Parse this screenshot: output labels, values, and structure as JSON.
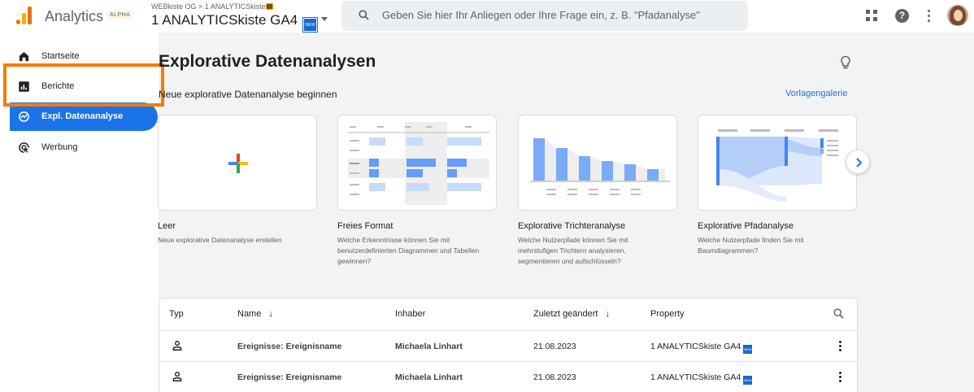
{
  "header": {
    "app_name": "Analytics",
    "app_badge": "ALPHA",
    "breadcrumb": "WEBkiste OG > 1 ANALYTICSkiste",
    "property_name": "1 ANALYTICSkiste GA4",
    "property_badge": "NEW",
    "search_placeholder": "Geben Sie hier Ihr Anliegen oder Ihre Frage ein, z. B. \"Pfadanalyse\""
  },
  "sidebar": {
    "items": [
      {
        "label": "Startseite",
        "icon": "home-icon"
      },
      {
        "label": "Berichte",
        "icon": "reports-icon"
      },
      {
        "label": "Expl. Datenanalyse",
        "icon": "explore-icon",
        "active": true
      },
      {
        "label": "Werbung",
        "icon": "advertising-icon"
      }
    ]
  },
  "main": {
    "title": "Explorative Datenanalysen",
    "section_label": "Neue explorative Datenanalyse beginnen",
    "gallery_link": "Vorlagengalerie",
    "templates": [
      {
        "title": "Leer",
        "description": "Neue explorative Datenanalyse erstellen"
      },
      {
        "title": "Freies Format",
        "description": "Welche Erkenntnisse können Sie mit benutzerdefinierten Diagrammen und Tabellen gewinnen?"
      },
      {
        "title": "Explorative Trichteranalyse",
        "description": "Welche Nutzerpfade können Sie mit mehrstufigen Trichtern analysieren, segmentieren und aufschlüsseln?"
      },
      {
        "title": "Explorative Pfadanalyse",
        "description": "Welche Nutzerpfade finden Sie mit Baumdiagrammen?"
      }
    ]
  },
  "table": {
    "columns": {
      "type": "Typ",
      "name": "Name",
      "owner": "Inhaber",
      "modified": "Zuletzt geändert",
      "property": "Property"
    },
    "rows": [
      {
        "name": "Ereignisse: Ereignisname",
        "owner": "Michaela Linhart",
        "modified": "21.08.2023",
        "property": "1 ANALYTICSkiste GA4",
        "badge": "NEW"
      },
      {
        "name": "Ereignisse: Ereignisname",
        "owner": "Michaela Linhart",
        "modified": "21.08.2023",
        "property": "1 ANALYTICSkiste GA4",
        "badge": "NEW"
      }
    ]
  },
  "colors": {
    "accent": "#1a73e8",
    "highlight": "#f57c00"
  }
}
